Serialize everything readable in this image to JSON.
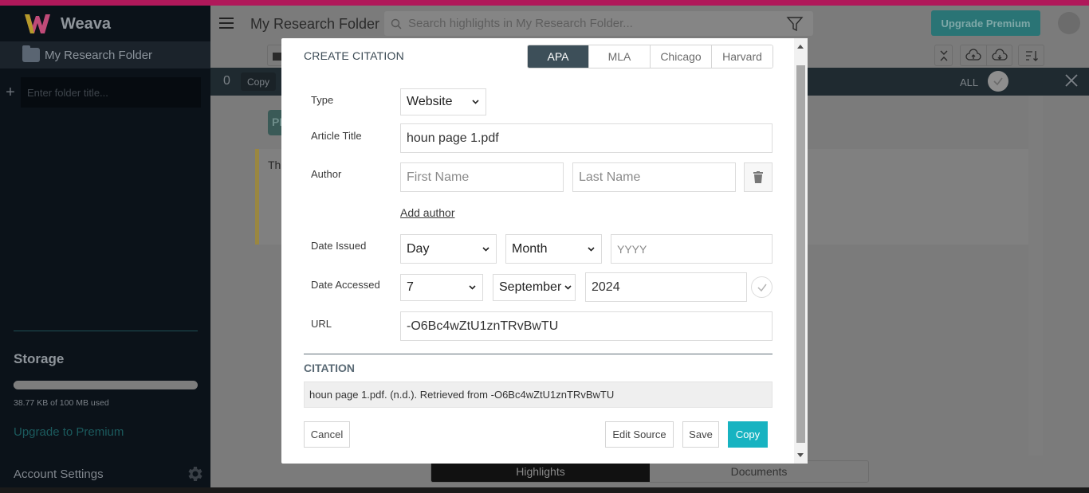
{
  "app": {
    "name": "Weava",
    "accent_color": "#17b3c1",
    "topbar_color": "#b0185a"
  },
  "sidebar": {
    "folder": {
      "label": "My Research Folder"
    },
    "new_folder_placeholder": "Enter folder title...",
    "storage": {
      "title": "Storage",
      "used_text": "38.77 KB of 100 MB used",
      "used_fraction": 0.0004
    },
    "upgrade_link": "Upgrade to Premium",
    "account_settings": "Account Settings"
  },
  "header": {
    "title": "My Research Folder",
    "search_placeholder": "Search highlights in My Research Folder...",
    "upgrade_button": "Upgrade Premium"
  },
  "selection_bar": {
    "count": "0",
    "copy_label": "Copy",
    "all_label": "ALL"
  },
  "content": {
    "doc_chip": "PDF",
    "highlight_preview": "Th"
  },
  "bottom_tabs": [
    {
      "label": "Highlights",
      "active": true
    },
    {
      "label": "Documents",
      "active": false
    }
  ],
  "modal": {
    "title": "CREATE CITATION",
    "styles": [
      {
        "label": "APA",
        "active": true
      },
      {
        "label": "MLA",
        "active": false
      },
      {
        "label": "Chicago",
        "active": false
      },
      {
        "label": "Harvard",
        "active": false
      }
    ],
    "type": {
      "label": "Type",
      "value": "Website"
    },
    "article_title": {
      "label": "Article Title",
      "value": "houn page 1.pdf"
    },
    "author": {
      "label": "Author",
      "first_placeholder": "First Name",
      "last_placeholder": "Last Name",
      "add_label": "Add author"
    },
    "date_issued": {
      "label": "Date Issued",
      "day": "Day",
      "month": "Month",
      "year_placeholder": "YYYY"
    },
    "date_accessed": {
      "label": "Date Accessed",
      "day": "7",
      "month": "September",
      "year": "2024"
    },
    "url": {
      "label": "URL",
      "value": "-O6Bc4wZtU1znTRvBwTU"
    },
    "citation": {
      "label": "CITATION",
      "text": "houn page 1.pdf. (n.d.). Retrieved from -O6Bc4wZtU1znTRvBwTU"
    },
    "buttons": {
      "cancel": "Cancel",
      "edit_source": "Edit Source",
      "save": "Save",
      "copy": "Copy"
    }
  }
}
